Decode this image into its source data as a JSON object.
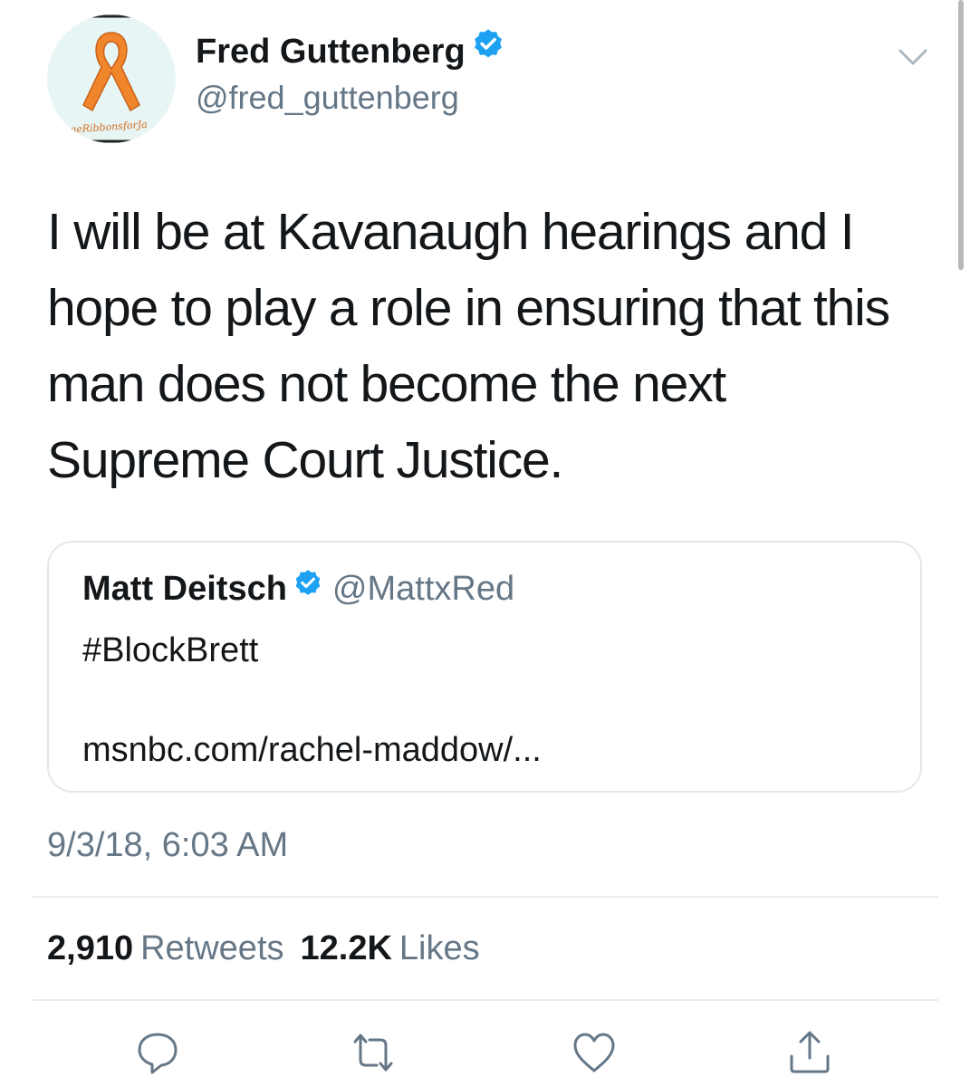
{
  "author": {
    "display_name": "Fred Guttenberg",
    "handle": "@fred_guttenberg",
    "verified": true,
    "avatar_caption": "ngeRibbonsforJa"
  },
  "tweet": {
    "text": "I will be at Kavanaugh hearings and I hope to play a role in ensuring that this man does not become the next Supreme Court Justice.",
    "timestamp": "9/3/18, 6:03 AM"
  },
  "quoted_tweet": {
    "display_name": "Matt Deitsch",
    "handle": "@MattxRed",
    "verified": true,
    "text": "#BlockBrett",
    "link": "msnbc.com/rachel-maddow/..."
  },
  "stats": {
    "retweets_count": "2,910",
    "retweets_label": "Retweets",
    "likes_count": "12.2K",
    "likes_label": "Likes"
  },
  "actions": [
    "reply-icon",
    "retweet-icon",
    "like-icon",
    "share-icon"
  ],
  "colors": {
    "verified_blue": "#1da1f2",
    "secondary_text": "#657786",
    "primary_text": "#14171a",
    "ribbon_orange": "#f0862c"
  }
}
